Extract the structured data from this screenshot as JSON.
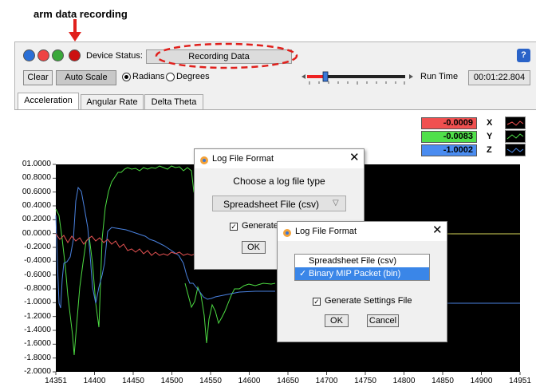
{
  "annotation": {
    "label": "arm data recording",
    "arrow_color": "#e0201c"
  },
  "toolbar": {
    "device_status_label": "Device Status:",
    "device_status_value": "Recording Data",
    "clear_label": "Clear",
    "auto_scale_label": "Auto Scale",
    "radians_label": "Radians",
    "degrees_label": "Degrees",
    "unit_selected": "Radians",
    "run_time_label": "Run Time",
    "run_time_value": "00:01:22.804",
    "help_label": "?"
  },
  "tabs": [
    "Acceleration",
    "Angular Rate",
    "Delta Theta"
  ],
  "active_tab": "Acceleration",
  "legend": [
    {
      "value": "-0.0009",
      "axis": "X",
      "color": "#f05050"
    },
    {
      "value": "-0.0083",
      "axis": "Y",
      "color": "#50e04a"
    },
    {
      "value": "-1.0002",
      "axis": "Z",
      "color": "#4a8cf0"
    }
  ],
  "plot": {
    "y_ticks": [
      "01.0000",
      "00.8000",
      "00.6000",
      "00.4000",
      "00.2000",
      "00.0000",
      "-0.2000",
      "-0.4000",
      "-0.6000",
      "-0.8000",
      "-1.0000",
      "-1.2000",
      "-1.4000",
      "-1.6000",
      "-1.8000",
      "-2.0000"
    ],
    "x_ticks": [
      "14351",
      "14400",
      "14450",
      "14500",
      "14550",
      "14600",
      "14650",
      "14700",
      "14750",
      "14800",
      "14850",
      "14900",
      "14951"
    ]
  },
  "dialog1": {
    "title": "Log File Format",
    "prompt": "Choose a log file type",
    "select_value": "Spreadsheet File (csv)",
    "checkbox_label": "Generate",
    "ok_label": "OK"
  },
  "dialog2": {
    "title": "Log File Format",
    "options": [
      "Spreadsheet File (csv)",
      "Binary MIP Packet (bin)"
    ],
    "selected_option": "Binary MIP Packet (bin)",
    "selected_mark": "✓",
    "checkbox_label": "Generate Settings File",
    "ok_label": "OK",
    "cancel_label": "Cancel"
  }
}
